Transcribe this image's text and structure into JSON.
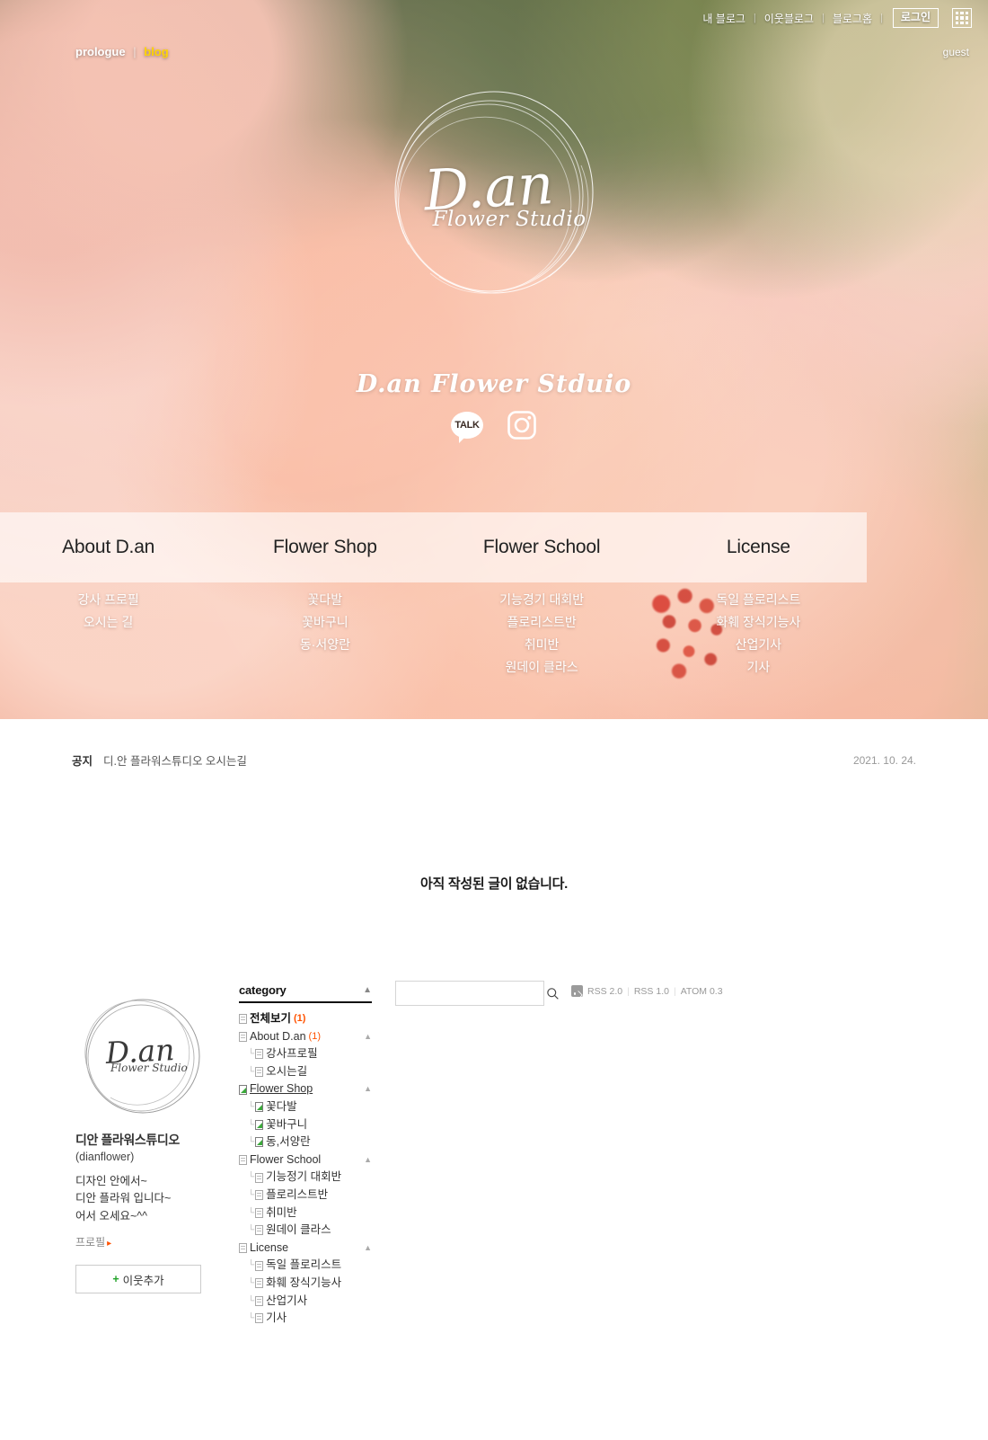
{
  "gnb": {
    "items": [
      "내 블로그",
      "이웃블로그",
      "블로그홈"
    ],
    "login_label": "로그인",
    "grid_icon": "grid-icon",
    "guest_label": "guest"
  },
  "prologue_blog": {
    "prologue": "prologue",
    "separator": "|",
    "blog": "blog",
    "blog_color": "#ffd400"
  },
  "cover": {
    "logo": {
      "script_text": "D.an",
      "sub_text": "Flower Studio"
    },
    "blog_title": "D.an Flower Stduio",
    "sns": [
      {
        "name": "kakaotalk-icon",
        "label": "TALK"
      },
      {
        "name": "instagram-icon",
        "label": ""
      }
    ],
    "menu": [
      {
        "label": "About D.an",
        "sub": [
          "강사 프로필",
          "오시는 길"
        ]
      },
      {
        "label": "Flower Shop",
        "sub": [
          "꽃다발",
          "꽃바구니",
          "동·서양란"
        ]
      },
      {
        "label": "Flower School",
        "sub": [
          "기능경기 대회반",
          "플로리스트반",
          "취미반",
          "원데이 클라스"
        ]
      },
      {
        "label": "License",
        "sub": [
          "독일 플로리스트",
          "화훼 장식기능사",
          "산업기사",
          "기사"
        ]
      }
    ]
  },
  "notice": {
    "tag": "공지",
    "text": "디.안 플라워스튜디오 오시는길",
    "date": "2021. 10. 24."
  },
  "empty_state": {
    "message": "아직 작성된 글이 없습니다."
  },
  "profile": {
    "image_script": "D.an",
    "image_sub": "Flower Studio",
    "name": "디안 플라워스튜디오",
    "id": "(dianflower)",
    "description": "디자인 안에서~\n디안 플라워 입니다~\n어서 오세요~^^",
    "profile_link": "프로필",
    "profile_arrow": "▸",
    "neighbor_button": "이웃추가",
    "neighbor_plus": "+"
  },
  "category": {
    "title": "category",
    "collapse_icon": "chevron-up-icon",
    "items": [
      {
        "label": "전체보기",
        "count": "(1)",
        "depth": 1,
        "icon": "doc-icon",
        "bold": true,
        "caret": ""
      },
      {
        "label": "About D.an",
        "count": "(1)",
        "depth": 1,
        "icon": "doc-icon",
        "bold": false,
        "caret": "▲"
      },
      {
        "label": "강사프로필",
        "count": "",
        "depth": 2,
        "icon": "doc-icon",
        "bold": false,
        "caret": ""
      },
      {
        "label": "오시는길",
        "count": "",
        "depth": 2,
        "icon": "doc-icon",
        "bold": false,
        "caret": ""
      },
      {
        "label": "Flower Shop",
        "count": "",
        "depth": 1,
        "icon": "image-icon",
        "bold": false,
        "caret": "▲",
        "hover": true
      },
      {
        "label": "꽃다발",
        "count": "",
        "depth": 2,
        "icon": "image-icon",
        "bold": false,
        "caret": ""
      },
      {
        "label": "꽃바구니",
        "count": "",
        "depth": 2,
        "icon": "image-icon",
        "bold": false,
        "caret": ""
      },
      {
        "label": "동,서양란",
        "count": "",
        "depth": 2,
        "icon": "image-icon",
        "bold": false,
        "caret": ""
      },
      {
        "label": "Flower School",
        "count": "",
        "depth": 1,
        "icon": "doc-icon",
        "bold": false,
        "caret": "▲"
      },
      {
        "label": "기능정기 대회반",
        "count": "",
        "depth": 2,
        "icon": "doc-icon",
        "bold": false,
        "caret": ""
      },
      {
        "label": "플로리스트반",
        "count": "",
        "depth": 2,
        "icon": "doc-icon",
        "bold": false,
        "caret": ""
      },
      {
        "label": "취미반",
        "count": "",
        "depth": 2,
        "icon": "doc-icon",
        "bold": false,
        "caret": ""
      },
      {
        "label": "원데이 클라스",
        "count": "",
        "depth": 2,
        "icon": "doc-icon",
        "bold": false,
        "caret": ""
      },
      {
        "label": "License",
        "count": "",
        "depth": 1,
        "icon": "doc-icon",
        "bold": false,
        "caret": "▲"
      },
      {
        "label": "독일 플로리스트",
        "count": "",
        "depth": 2,
        "icon": "doc-icon",
        "bold": false,
        "caret": ""
      },
      {
        "label": "화훼 장식기능사",
        "count": "",
        "depth": 2,
        "icon": "doc-icon",
        "bold": false,
        "caret": ""
      },
      {
        "label": "산업기사",
        "count": "",
        "depth": 2,
        "icon": "doc-icon",
        "bold": false,
        "caret": ""
      },
      {
        "label": "기사",
        "count": "",
        "depth": 2,
        "icon": "doc-icon",
        "bold": false,
        "caret": ""
      }
    ]
  },
  "search": {
    "value": "",
    "placeholder": "",
    "icon": "search-icon"
  },
  "rss": {
    "icon": "rss-icon",
    "links": [
      "RSS 2.0",
      "RSS 1.0",
      "ATOM 0.3"
    ],
    "separator": "|"
  }
}
